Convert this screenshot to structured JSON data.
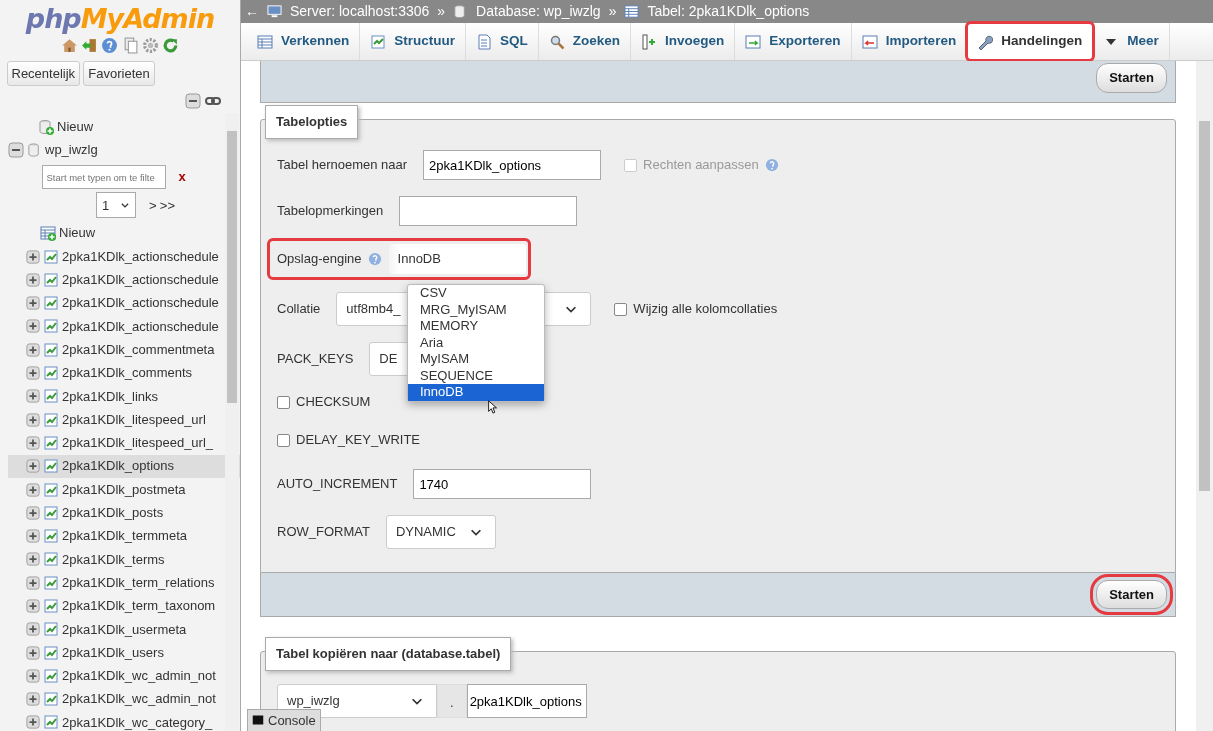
{
  "sidebar": {
    "logo": {
      "php": "php",
      "rest": "MyAdmin"
    },
    "buttons": [
      "Recentelijk",
      "Favorieten"
    ],
    "tree": [
      {
        "kind": "new-db",
        "label": "Nieuw"
      },
      {
        "kind": "db",
        "label": "wp_iwzlg",
        "expanded": true,
        "filter": {
          "placeholder": "Start met typen om te filte",
          "clear": "x"
        },
        "pager": {
          "page": "1",
          "next": ">",
          "last": ">>"
        },
        "children": [
          {
            "kind": "new-table",
            "label": "Nieuw",
            "selected": false
          },
          {
            "kind": "table",
            "label": "2pka1KDlk_actionschedule",
            "selected": false
          },
          {
            "kind": "table",
            "label": "2pka1KDlk_actionschedule",
            "selected": false
          },
          {
            "kind": "table",
            "label": "2pka1KDlk_actionschedule",
            "selected": false
          },
          {
            "kind": "table",
            "label": "2pka1KDlk_actionschedule",
            "selected": false
          },
          {
            "kind": "table",
            "label": "2pka1KDlk_commentmeta",
            "selected": false
          },
          {
            "kind": "table",
            "label": "2pka1KDlk_comments",
            "selected": false
          },
          {
            "kind": "table",
            "label": "2pka1KDlk_links",
            "selected": false
          },
          {
            "kind": "table",
            "label": "2pka1KDlk_litespeed_url",
            "selected": false
          },
          {
            "kind": "table",
            "label": "2pka1KDlk_litespeed_url_",
            "selected": false
          },
          {
            "kind": "table",
            "label": "2pka1KDlk_options",
            "selected": true
          },
          {
            "kind": "table",
            "label": "2pka1KDlk_postmeta",
            "selected": false
          },
          {
            "kind": "table",
            "label": "2pka1KDlk_posts",
            "selected": false
          },
          {
            "kind": "table",
            "label": "2pka1KDlk_termmeta",
            "selected": false
          },
          {
            "kind": "table",
            "label": "2pka1KDlk_terms",
            "selected": false
          },
          {
            "kind": "table",
            "label": "2pka1KDlk_term_relations",
            "selected": false
          },
          {
            "kind": "table",
            "label": "2pka1KDlk_term_taxonom",
            "selected": false
          },
          {
            "kind": "table",
            "label": "2pka1KDlk_usermeta",
            "selected": false
          },
          {
            "kind": "table",
            "label": "2pka1KDlk_users",
            "selected": false
          },
          {
            "kind": "table",
            "label": "2pka1KDlk_wc_admin_not",
            "selected": false
          },
          {
            "kind": "table",
            "label": "2pka1KDlk_wc_admin_not",
            "selected": false
          },
          {
            "kind": "table",
            "label": "2pka1KDlk_wc_category_",
            "selected": false
          }
        ]
      }
    ]
  },
  "breadcrumb": {
    "toggle": "←",
    "separator": "»",
    "items": [
      {
        "kind": "server",
        "label": "Server: localhost:3306"
      },
      {
        "kind": "database",
        "label": "Database: wp_iwzlg"
      },
      {
        "kind": "table",
        "label": "Tabel: 2pka1KDlk_options"
      }
    ]
  },
  "tabs": [
    {
      "kind": "browse",
      "label": "Verkennen",
      "selected": false,
      "highlighted": false
    },
    {
      "kind": "structure",
      "label": "Structuur",
      "selected": false,
      "highlighted": false
    },
    {
      "kind": "sql",
      "label": "SQL",
      "selected": false,
      "highlighted": false
    },
    {
      "kind": "search",
      "label": "Zoeken",
      "selected": false,
      "highlighted": false
    },
    {
      "kind": "insert",
      "label": "Invoegen",
      "selected": false,
      "highlighted": false
    },
    {
      "kind": "export",
      "label": "Exporteren",
      "selected": false,
      "highlighted": false
    },
    {
      "kind": "import",
      "label": "Importeren",
      "selected": false,
      "highlighted": false
    },
    {
      "kind": "operations",
      "label": "Handelingen",
      "selected": true,
      "highlighted": true
    },
    {
      "kind": "more",
      "label": "Meer",
      "selected": false,
      "highlighted": false
    }
  ],
  "previous_submit": {
    "label": "Starten"
  },
  "table_options": {
    "legend": "Tabelopties",
    "rows": [
      {
        "kind": "text",
        "label": "Tabel hernoemen naar",
        "value": "2pka1KDlk_options",
        "checkbox": {
          "label": "Rechten aanpassen",
          "checked": false,
          "disabled": true,
          "help": true
        }
      },
      {
        "kind": "text",
        "label": "Tabelopmerkingen"
      },
      {
        "kind": "select",
        "label": "Opslag-engine",
        "help": true,
        "value": "InnoDB",
        "highlighted": true,
        "open": true,
        "options": [
          {
            "label": "CSV",
            "selected": false
          },
          {
            "label": "MRG_MyISAM",
            "selected": false
          },
          {
            "label": "MEMORY",
            "selected": false
          },
          {
            "label": "Aria",
            "selected": false
          },
          {
            "label": "MyISAM",
            "selected": false
          },
          {
            "label": "SEQUENCE",
            "selected": false
          },
          {
            "label": "InnoDB",
            "selected": true
          }
        ]
      },
      {
        "kind": "select",
        "label": "Collatie",
        "value": "utf8mb4_",
        "checkbox": {
          "label": "Wijzig alle kolomcollaties",
          "checked": false,
          "disabled": false
        }
      },
      {
        "kind": "select",
        "label": "PACK_KEYS",
        "value": "DE"
      },
      {
        "kind": "check",
        "label": "CHECKSUM",
        "checked": false
      },
      {
        "kind": "check",
        "label": "DELAY_KEY_WRITE",
        "checked": false
      },
      {
        "kind": "text",
        "label": "AUTO_INCREMENT",
        "value": "1740"
      },
      {
        "kind": "select",
        "label": "ROW_FORMAT",
        "value": "DYNAMIC"
      }
    ],
    "submit": {
      "label": "Starten",
      "highlighted": true
    }
  },
  "copy_table": {
    "legend": "Tabel kopiëren naar (database.tabel)",
    "database": "wp_iwzlg",
    "dot": ".",
    "table": "2pka1KDlk_options"
  },
  "console": {
    "label": "Console"
  }
}
